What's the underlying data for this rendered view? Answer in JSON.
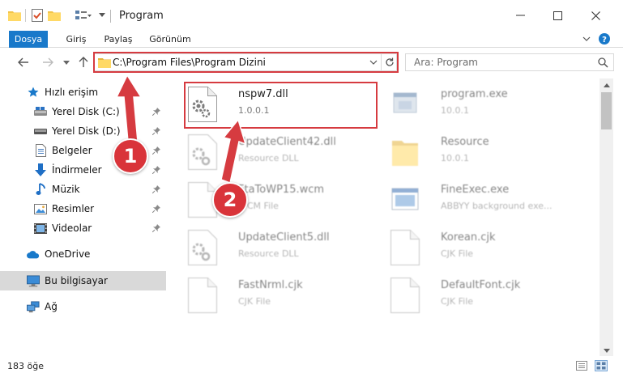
{
  "window": {
    "title": "Program"
  },
  "ribbon": {
    "tabs": [
      "Dosya",
      "Giriş",
      "Paylaş",
      "Görünüm"
    ]
  },
  "address": {
    "path": "C:\\Program Files\\Program Dizini"
  },
  "search": {
    "placeholder": "Ara: Program"
  },
  "sidebar": {
    "items": [
      {
        "label": "Hızlı erişim",
        "icon": "star-icon"
      },
      {
        "label": "Yerel Disk (C:)",
        "icon": "drive-icon"
      },
      {
        "label": "Yerel Disk (D:)",
        "icon": "drive-icon"
      },
      {
        "label": "Belgeler",
        "icon": "documents-icon"
      },
      {
        "label": "İndirmeler",
        "icon": "download-icon"
      },
      {
        "label": "Müzik",
        "icon": "music-icon"
      },
      {
        "label": "Resimler",
        "icon": "pictures-icon"
      },
      {
        "label": "Videolar",
        "icon": "videos-icon"
      },
      {
        "label": "OneDrive",
        "icon": "cloud-icon"
      },
      {
        "label": "Bu bilgisayar",
        "icon": "computer-icon"
      },
      {
        "label": "Ağ",
        "icon": "network-icon"
      }
    ]
  },
  "files": [
    {
      "name": "nspw7.dll",
      "sub": "1.0.0.1",
      "icon": "gear-file-icon"
    },
    {
      "name": "program.exe",
      "sub": "10.0.1",
      "icon": "exe-icon"
    },
    {
      "name": "UpdateClient42.dll",
      "sub": "Resource DLL",
      "icon": "gear-file-icon"
    },
    {
      "name": "Resource",
      "sub": "10.0.1",
      "icon": "folder-icon"
    },
    {
      "name": "FtaToWP15.wcm",
      "sub": "WCM File",
      "icon": "blank-file-icon"
    },
    {
      "name": "FineExec.exe",
      "sub": "ABBYY background exe...",
      "icon": "window-exe-icon"
    },
    {
      "name": "UpdateClient5.dll",
      "sub": "Resource DLL",
      "icon": "gear-file-icon"
    },
    {
      "name": "Korean.cjk",
      "sub": "CJK File",
      "icon": "blank-file-icon"
    },
    {
      "name": "FastNrml.cjk",
      "sub": "CJK File",
      "icon": "blank-file-icon"
    },
    {
      "name": "DefaultFont.cjk",
      "sub": "CJK File",
      "icon": "blank-file-icon"
    }
  ],
  "status": {
    "count": "183 öğe"
  },
  "annotations": {
    "step1": "1",
    "step2": "2"
  },
  "colors": {
    "accent": "#1979ca",
    "annotation": "#d63b40",
    "selected": "#d9d9d9"
  }
}
